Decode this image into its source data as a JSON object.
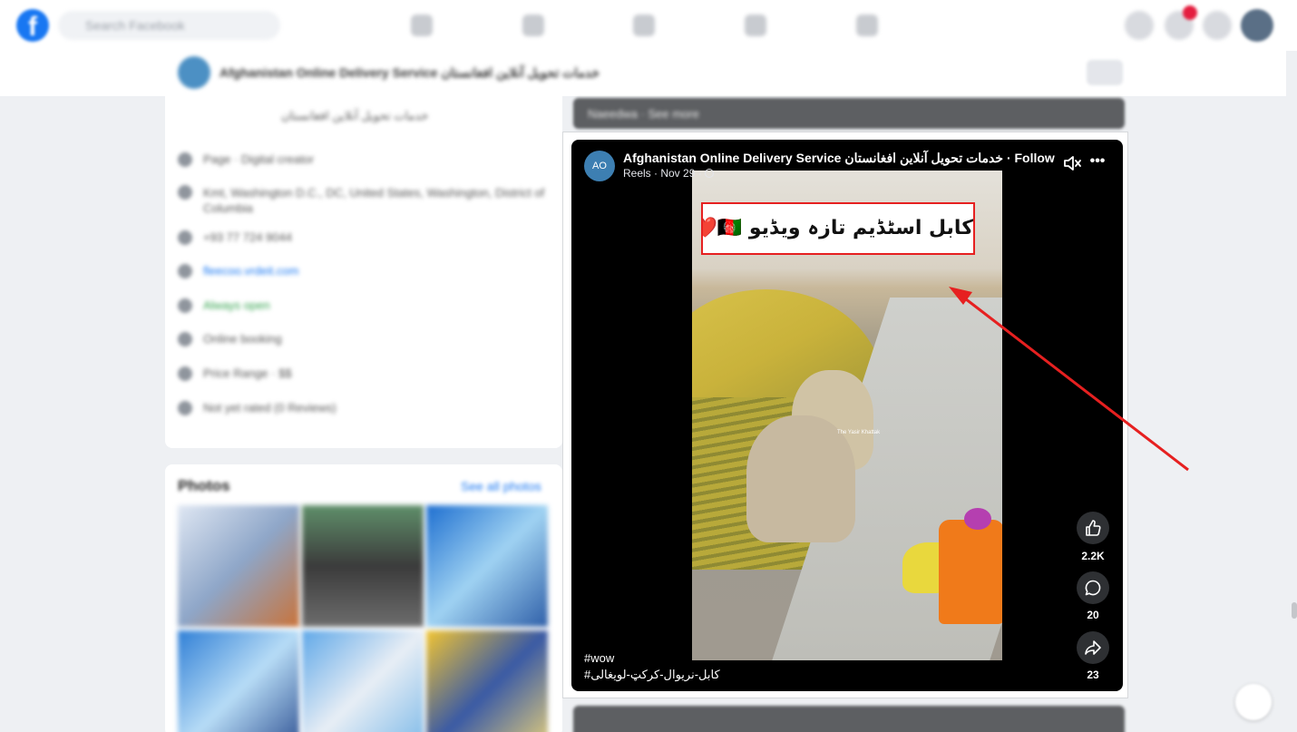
{
  "topbar": {
    "search_placeholder": "Search Facebook"
  },
  "page_header": {
    "title": "Afghanistan Online Delivery Service خدمات تحویل آنلاین افغانستان"
  },
  "intro": {
    "title": "خدمات تحویل آنلاین افغانستان",
    "rows": [
      {
        "icon": "info-icon",
        "label": "Page · Digital creator"
      },
      {
        "icon": "location-icon",
        "label": "Kmt, Washington D.C., DC, United States, Washington, District of Columbia"
      },
      {
        "icon": "phone-icon",
        "label": "+93 77 724 9044"
      },
      {
        "icon": "globe-icon",
        "label": "fleecoo.vrdeit.com"
      },
      {
        "icon": "clock-icon",
        "label": "Always open"
      },
      {
        "icon": "calendar-icon",
        "label": "Online booking"
      },
      {
        "icon": "tag-icon",
        "label": "Price Range · $$"
      },
      {
        "icon": "star-icon",
        "label": "Not yet rated (0 Reviews)"
      }
    ]
  },
  "photos": {
    "title": "Photos",
    "see_all": "See all photos"
  },
  "post_strip": {
    "text": "Naeedwa · See more"
  },
  "reel": {
    "author": "Afghanistan Online Delivery Service",
    "author_urdu": "خدمات تحویل آنلاین افغانستان",
    "follow_label": " · Follow",
    "meta": "Reels · Nov 29 ·",
    "video_caption": "کابل اسٹڈیم تازہ ویڈیو 🇦🇫❤️🏏",
    "watermark": "The Yasir Khattak",
    "likes": "2.2K",
    "comments": "20",
    "shares": "23",
    "hashtag_line_1": "#wow",
    "hashtag_line_2": "#کابل-نریوال-کرکټ-لویغالی"
  },
  "colors": {
    "facebook_blue": "#1877f2",
    "annotation_red": "#e62020",
    "reel_background": "#000000"
  }
}
